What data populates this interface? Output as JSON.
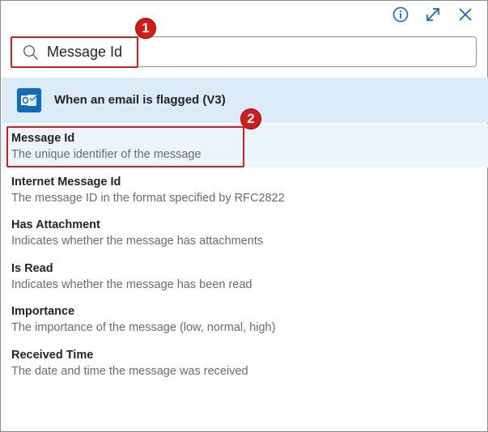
{
  "search": {
    "value": "Message Id"
  },
  "annotations": [
    "1",
    "2"
  ],
  "section": {
    "title": "When an email is flagged (V3)",
    "icon": "outlook-icon"
  },
  "icons": {
    "info": "info-icon",
    "expand": "expand-icon",
    "close": "close-icon",
    "search": "search-icon"
  },
  "colors": {
    "accent": "#0f6cbd",
    "header_bg": "#dcebf8",
    "selected_bg": "#edf5fc",
    "annotation": "#cc1f1f"
  },
  "items": [
    {
      "title": "Message Id",
      "description": "The unique identifier of the message",
      "selected": true
    },
    {
      "title": "Internet Message Id",
      "description": "The message ID in the format specified by RFC2822"
    },
    {
      "title": "Has Attachment",
      "description": "Indicates whether the message has attachments"
    },
    {
      "title": "Is Read",
      "description": "Indicates whether the message has been read"
    },
    {
      "title": "Importance",
      "description": "The importance of the message (low, normal, high)"
    },
    {
      "title": "Received Time",
      "description": "The date and time the message was received"
    }
  ]
}
